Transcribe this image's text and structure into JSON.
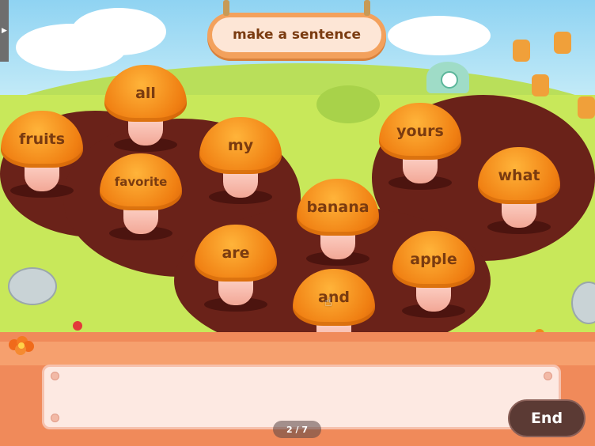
{
  "title": "make a sentence",
  "mushrooms": [
    {
      "word": "all"
    },
    {
      "word": "fruits"
    },
    {
      "word": "my"
    },
    {
      "word": "favorite"
    },
    {
      "word": "yours"
    },
    {
      "word": "what"
    },
    {
      "word": "banana"
    },
    {
      "word": "are"
    },
    {
      "word": "apple"
    },
    {
      "word": "and"
    }
  ],
  "end_label": "End",
  "page_indicator": "2 / 7",
  "side_tab_icon": "▶",
  "colors": {
    "cap": "#f08a1a",
    "word_text": "#7a3b10",
    "dirt": "#6a2219",
    "grass": "#c8e85a",
    "end_button": "#5b3a34"
  },
  "icons": [
    "hand-pointer-icon",
    "play-arrow-icon",
    "flower-icon"
  ]
}
